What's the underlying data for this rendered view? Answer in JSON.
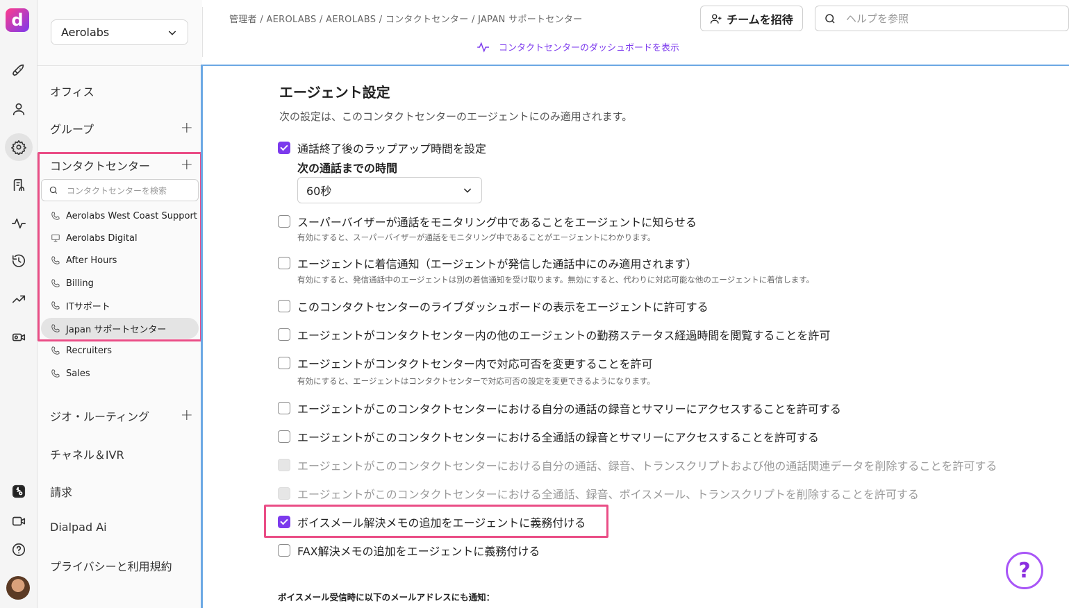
{
  "app": {
    "logo_letter": "d"
  },
  "rail": {
    "icons": [
      "rocket-icon",
      "user-icon",
      "gear-icon",
      "contacts-icon",
      "activity-icon",
      "history-icon",
      "trending-icon",
      "video-icon",
      "dialpad-app-icon",
      "meeting-icon",
      "help-circle-icon"
    ]
  },
  "sidebar": {
    "workspace": "Aerolabs",
    "items": [
      {
        "label": "オフィス"
      },
      {
        "label": "グループ",
        "plus": "+"
      },
      {
        "label": "コンタクトセンター",
        "plus": "+"
      },
      {
        "label": "ジオ・ルーティング",
        "plus": "+"
      },
      {
        "label": "チャネル＆IVR"
      },
      {
        "label": "請求"
      },
      {
        "label": "Dialpad Ai"
      },
      {
        "label": "プライバシーと利用規約"
      }
    ],
    "cc_search_placeholder": "コンタクトセンターを検索",
    "contact_centers": [
      {
        "label": "Aerolabs West Coast Support",
        "icon": "phone-icon"
      },
      {
        "label": "Aerolabs Digital",
        "icon": "monitor-icon"
      },
      {
        "label": "After Hours",
        "icon": "phone-icon"
      },
      {
        "label": "Billing",
        "icon": "phone-icon"
      },
      {
        "label": "ITサポート",
        "icon": "phone-icon"
      },
      {
        "label": "Japan サポートセンター",
        "icon": "phone-icon",
        "selected": true
      },
      {
        "label": "Recruiters",
        "icon": "phone-icon"
      },
      {
        "label": "Sales",
        "icon": "phone-icon"
      }
    ]
  },
  "header": {
    "breadcrumb": "管理者 / AEROLABS / AEROLABS / コンタクトセンター / JAPAN サポートセンター",
    "invite_label": "チームを招待",
    "help_placeholder": "ヘルプを参照",
    "dashboard_link": "コンタクトセンターのダッシュボードを表示"
  },
  "main": {
    "title": "エージェント設定",
    "description": "次の設定は、このコンタクトセンターのエージェントにのみ適用されます。",
    "wrapup": {
      "label": "通話終了後のラップアップ時間を設定",
      "checked": true,
      "time_label": "次の通話までの時間",
      "time_value": "60秒"
    },
    "options": [
      {
        "label": "スーパーバイザーが通話をモニタリング中であることをエージェントに知らせる",
        "checked": false,
        "sub": "有効にすると、スーパーバイザーが通話をモニタリング中であることがエージェントにわかります。"
      },
      {
        "label": "エージェントに着信通知（エージェントが発信した通話中にのみ適用されます）",
        "checked": false,
        "sub": "有効にすると、発信通話中のエージェントは別の着信通知を受け取ります。無効にすると、代わりに対応可能な他のエージェントに着信します。"
      },
      {
        "label": "このコンタクトセンターのライブダッシュボードの表示をエージェントに許可する",
        "checked": false
      },
      {
        "label": "エージェントがコンタクトセンター内の他のエージェントの勤務ステータス経過時間を閲覧することを許可",
        "checked": false
      },
      {
        "label": "エージェントがコンタクトセンター内で対応可否を変更することを許可",
        "checked": false,
        "sub": "有効にすると、エージェントはコンタクトセンターで対応可否の設定を変更できるようになります。"
      },
      {
        "label": "エージェントがこのコンタクトセンターにおける自分の通話の録音とサマリーにアクセスすることを許可する",
        "checked": false
      },
      {
        "label": "エージェントがこのコンタクトセンターにおける全通話の録音とサマリーにアクセスすることを許可する",
        "checked": false
      },
      {
        "label": "エージェントがこのコンタクトセンターにおける自分の通話、録音、トランスクリプトおよび他の通話関連データを削除することを許可する",
        "checked": false,
        "disabled": true
      },
      {
        "label": "エージェントがこのコンタクトセンターにおける全通話、録音、ボイスメール、トランスクリプトを削除することを許可する",
        "checked": false,
        "disabled": true
      },
      {
        "label": "ボイスメール解決メモの追加をエージェントに義務付ける",
        "checked": true
      },
      {
        "label": "FAX解決メモの追加をエージェントに義務付ける",
        "checked": false
      }
    ],
    "email_notify_label": "ボイスメール受信時に以下のメールアドレスにも通知："
  },
  "help_fab": "?",
  "colors": {
    "accent": "#7c3aed",
    "highlight": "#ea4d86",
    "focus": "#6ba8e4"
  }
}
